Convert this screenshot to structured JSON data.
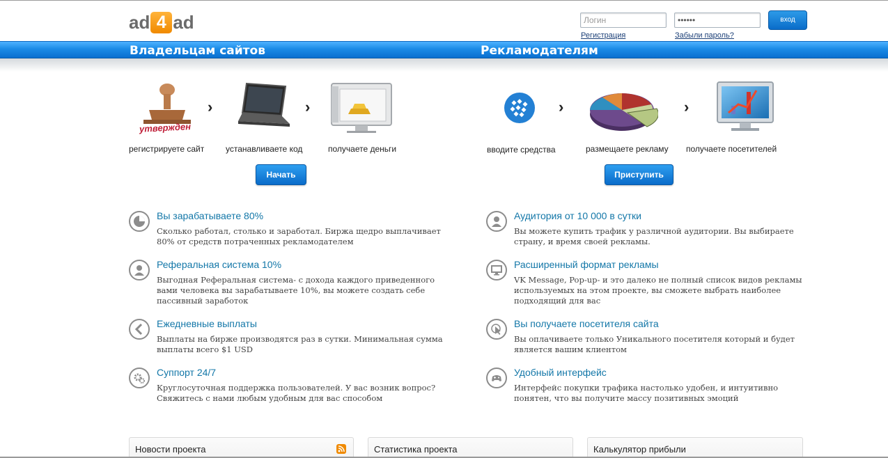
{
  "header": {
    "logo_left": "ad",
    "logo_mid": "4",
    "logo_right": "ad",
    "login_placeholder": "Логин",
    "password_value": "••••••",
    "login_button": "вход",
    "register_link": "Регистрация",
    "forgot_link": "Забыли пароль?"
  },
  "sections": {
    "owners_title": "Владельцам сайтов",
    "advertisers_title": "Рекламодателям"
  },
  "owners_steps": [
    {
      "label": "регистрируете сайт",
      "icon": "stamp-icon",
      "stamp_text": "утвержден"
    },
    {
      "label": "устанавливаете код",
      "icon": "laptop-icon"
    },
    {
      "label": "получаете деньги",
      "icon": "safe-gold-icon"
    }
  ],
  "advertisers_steps": [
    {
      "label": "вводите средства",
      "icon": "webmoney-icon"
    },
    {
      "label": "размещаете рекламу",
      "icon": "pie-chart-icon"
    },
    {
      "label": "получаете посетителей",
      "icon": "monitor-chart-icon"
    }
  ],
  "buttons": {
    "start": "Начать",
    "proceed": "Приступить"
  },
  "owners_features": [
    {
      "title": "Вы зарабатываете 80%",
      "text": "Сколько работал, столько и заработал. Биржа щедро выплачивает 80% от средств потраченных рекламодателем",
      "icon": "pie-icon"
    },
    {
      "title": "Реферальная система 10%",
      "text": "Выгодная Реферальная система- с дохода каждого приведенного вами человека вы зарабатываете 10%, вы можете создать себе пассивный заработок",
      "icon": "user-icon"
    },
    {
      "title": "Ежедневные выплаты",
      "text": "Выплаты на бирже производятся раз в сутки. Минимальная сумма выплаты всего $1 USD",
      "icon": "chevron-left-icon"
    },
    {
      "title": "Суппорт 24/7",
      "text": "Круглосуточная поддержка пользователей. У вас возник вопрос? Свяжитесь с нами любым удобным для вас способом",
      "icon": "gears-icon"
    }
  ],
  "advertisers_features": [
    {
      "title": "Аудитория от 10 000 в сутки",
      "text": "Вы можете купить трафик у различной аудитории. Вы выбираете страну, и время своей рекламы.",
      "icon": "user-icon"
    },
    {
      "title": "Расширенный формат рекламы",
      "text": "VK Message, Pop-up- и это далеко не полный список видов рекламы используемых на этом проекте, вы сможете выбрать наиболее подходящий для вас",
      "icon": "monitor-icon"
    },
    {
      "title": "Вы получаете посетителя сайта",
      "text": "Вы оплачиваете только Уникального посетителя который и будет является вашим клиентом",
      "icon": "cursor-icon"
    },
    {
      "title": "Удобный интерфейс",
      "text": "Интерфейс покупки трафика настолько удобен, и интуитивно понятен, что вы получите массу позитивных эмоций",
      "icon": "gamepad-icon"
    }
  ],
  "boxes": {
    "news": "Новости проекта",
    "stats": "Статистика проекта",
    "calc": "Калькулятор прибыли"
  }
}
